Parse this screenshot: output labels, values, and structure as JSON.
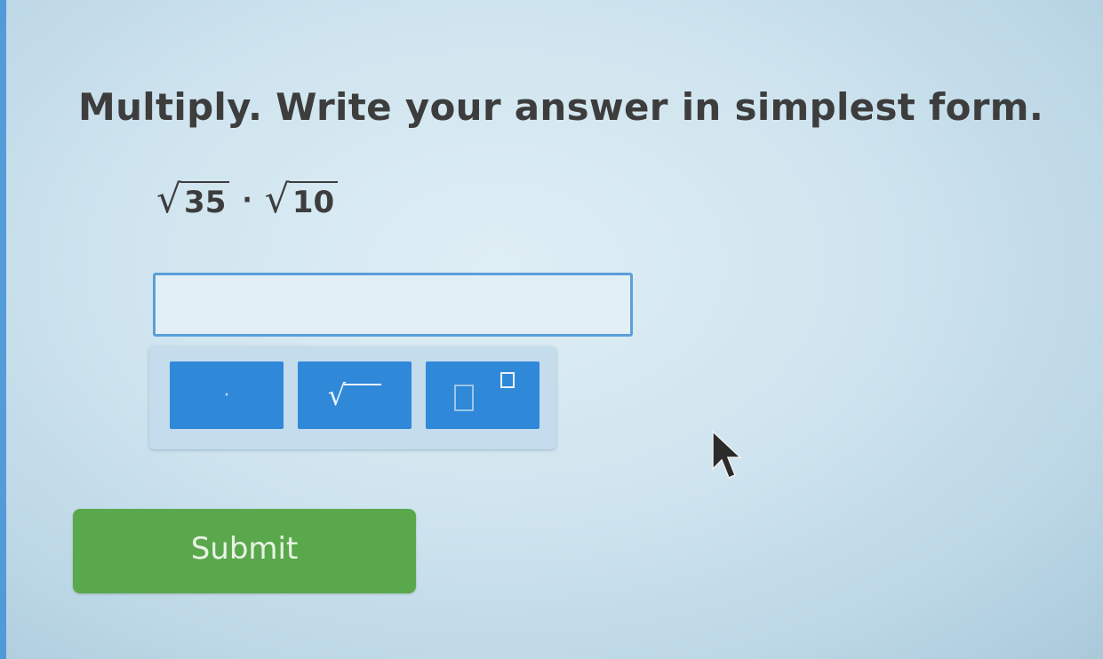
{
  "question": {
    "prompt": "Multiply. Write your answer in simplest form.",
    "expression": {
      "radicand_1": "35",
      "operator": "·",
      "radicand_2": "10"
    }
  },
  "answer_input": {
    "value": ""
  },
  "keypad": {
    "keys": [
      {
        "name": "multiply-dot",
        "glyph": "·"
      },
      {
        "name": "square-root",
        "glyph": "√"
      },
      {
        "name": "exponent",
        "glyph": "□□"
      }
    ]
  },
  "submit": {
    "label": "Submit"
  },
  "colors": {
    "background": "#d3e6f0",
    "key_blue": "#2f88d8",
    "input_border": "#5a9fd8",
    "submit_green": "#5aa84c",
    "text": "#3d3d3d"
  }
}
